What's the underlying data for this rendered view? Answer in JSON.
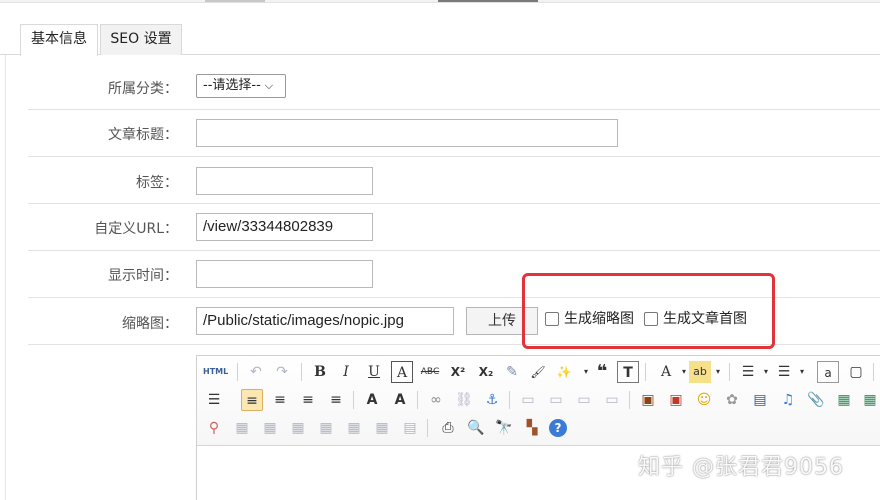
{
  "tabs": [
    {
      "label": "基本信息"
    },
    {
      "label": "SEO 设置"
    }
  ],
  "form": {
    "category": {
      "label": "所属分类：",
      "selected": "--请选择--"
    },
    "title": {
      "label": "文章标题：",
      "value": ""
    },
    "tags": {
      "label": "标签：",
      "value": ""
    },
    "custom_url": {
      "label": "自定义URL：",
      "value": "/view/33344802839"
    },
    "display_time": {
      "label": "显示时间：",
      "value": ""
    },
    "thumbnail": {
      "label": "缩略图：",
      "value": "/Public/static/images/nopic.jpg",
      "upload_label": "上传",
      "gen_thumb_label": "生成缩略图",
      "gen_first_label": "生成文章首图"
    }
  },
  "editor": {
    "toolbar_row1": [
      "HTML",
      "↶",
      "↷",
      "B",
      "I",
      "U",
      "A",
      "ABC",
      "X²",
      "X₂",
      "✎",
      "🖌",
      "✨",
      "❝",
      "T",
      "A",
      "ab",
      "☰",
      "☰",
      "a",
      "▢"
    ],
    "toolbar_row2": [
      "☰",
      "≡",
      "≡",
      "≡",
      "≡",
      "A",
      "A",
      "∞",
      "⛓",
      "⚓",
      "▭",
      "▭",
      "▭",
      "▭",
      "▣",
      "▣",
      "☺",
      "✿",
      "▤",
      "♫",
      "📎",
      "▦",
      "▦"
    ],
    "toolbar_row3": [
      "⚲",
      "▦",
      "▦",
      "▦",
      "▦",
      "▦",
      "▦",
      "▤",
      "⎙",
      "🔍",
      "🔭",
      "▚",
      "?"
    ]
  },
  "watermark": "知乎 @张君君9056",
  "colors": {
    "highlight": "#e3333a",
    "selected_tool": "#fbe7b2",
    "help": "#3a7bd5"
  }
}
